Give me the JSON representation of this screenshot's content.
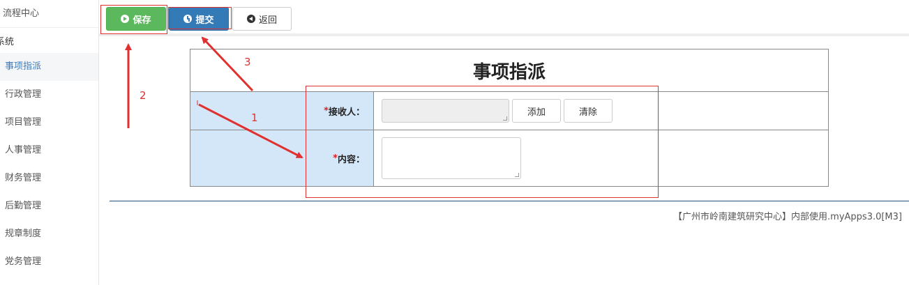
{
  "sidebar": {
    "header": "流程中心",
    "group": "系统",
    "items": [
      {
        "label": "事项指派",
        "active": true
      },
      {
        "label": "行政管理"
      },
      {
        "label": "项目管理"
      },
      {
        "label": "人事管理"
      },
      {
        "label": "财务管理"
      },
      {
        "label": "后勤管理"
      },
      {
        "label": "规章制度"
      },
      {
        "label": "党务管理"
      }
    ]
  },
  "toolbar": {
    "save_label": "保存",
    "submit_label": "提交",
    "back_label": "返回"
  },
  "form": {
    "title": "事项指派",
    "required_mark": "*",
    "receiver_label": "接收人：",
    "add_label": "添加",
    "clear_label": "清除",
    "content_label": "内容："
  },
  "footer": {
    "text": "【广州市岭南建筑研究中心】内部使用.myApps3.0[M3]"
  },
  "annotations": {
    "n1": "1",
    "n2": "2",
    "n3": "3",
    "color": "#e03030"
  },
  "colors": {
    "save": "#5cb85c",
    "submit": "#337ab7",
    "label_bg": "#d4e7f9",
    "active_text": "#3a7bbf"
  }
}
